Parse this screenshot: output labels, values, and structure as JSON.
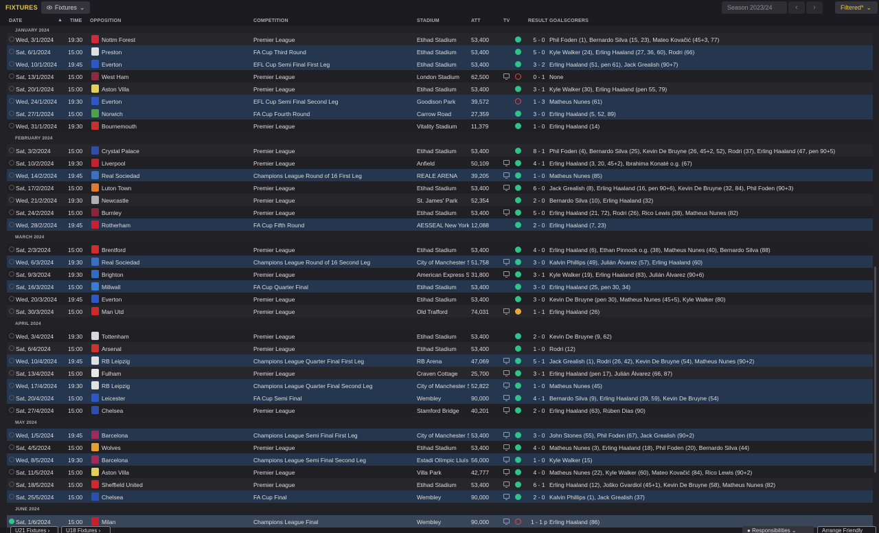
{
  "header": {
    "title": "FIXTURES",
    "view": "Fixtures",
    "season": "Season 2023/24",
    "filter": "Filtered*"
  },
  "columns": {
    "date": "DATE",
    "time": "TIME",
    "opposition": "OPPOSITION",
    "competition": "COMPETITION",
    "stadium": "STADIUM",
    "att": "ATT",
    "tv": "TV",
    "result": "RESULT",
    "goalscorers": "GOALSCORERS"
  },
  "footer": {
    "u21": "U21 Fixtures",
    "u18": "U18 Fixtures",
    "responsibilities": "Responsibilities",
    "arrange": "Arrange Friendly"
  },
  "colors": {
    "accent": "#e8c547",
    "win": "#2fc38a",
    "loss": "#e14a4a",
    "draw": "#e8a93a",
    "highlight": "#24374f"
  },
  "months": [
    {
      "label": "JANUARY 2024",
      "after": -1
    },
    {
      "label": "FEBRUARY 2024",
      "after": 7
    },
    {
      "label": "MARCH 2024",
      "after": 14
    },
    {
      "label": "APRIL 2024",
      "after": 20
    },
    {
      "label": "MAY 2024",
      "after": 27
    },
    {
      "label": "JUNE 2024",
      "after": 33
    }
  ],
  "fixtures": [
    {
      "date": "Wed, 3/1/2024",
      "time": "19:30",
      "opp": "Nottm Forest",
      "crest": "#d3283a",
      "comp": "Premier League",
      "stadium": "Etihad Stadium",
      "att": "53,400",
      "tv": false,
      "r": "W",
      "score": "5 - 0",
      "goals": "Phil Foden (1), Bernardo Silva (15, 23), Mateo Kovačić (45+3, 77)"
    },
    {
      "date": "Sat, 6/1/2024",
      "time": "15:00",
      "opp": "Preston",
      "crest": "#e0e0e0",
      "comp": "FA Cup Third Round",
      "stadium": "Etihad Stadium",
      "att": "53,400",
      "tv": false,
      "r": "W",
      "score": "5 - 0",
      "goals": "Kyle Walker (24), Erling Haaland (27, 36, 60), Rodri (66)"
    },
    {
      "date": "Wed, 10/1/2024",
      "time": "19:45",
      "opp": "Everton",
      "crest": "#2e58c9",
      "comp": "EFL Cup Semi Final First Leg",
      "stadium": "Etihad Stadium",
      "att": "53,400",
      "tv": false,
      "r": "W",
      "score": "3 - 2",
      "goals": "Erling Haaland (51, pen 61), Jack Grealish (90+7)"
    },
    {
      "date": "Sat, 13/1/2024",
      "time": "15:00",
      "opp": "West Ham",
      "crest": "#8e2a3d",
      "comp": "Premier League",
      "stadium": "London Stadium",
      "att": "62,500",
      "tv": true,
      "r": "L",
      "score": "0 - 1",
      "goals": "None"
    },
    {
      "date": "Sat, 20/1/2024",
      "time": "15:00",
      "opp": "Aston Villa",
      "crest": "#e0d05a",
      "comp": "Premier League",
      "stadium": "Etihad Stadium",
      "att": "53,400",
      "tv": false,
      "r": "W",
      "score": "3 - 1",
      "goals": "Kyle Walker (30), Erling Haaland (pen 55, 79)"
    },
    {
      "date": "Wed, 24/1/2024",
      "time": "19:30",
      "opp": "Everton",
      "crest": "#2e58c9",
      "comp": "EFL Cup Semi Final Second Leg",
      "stadium": "Goodison Park",
      "att": "39,572",
      "tv": false,
      "r": "L",
      "score": "1 - 3",
      "goals": "Matheus Nunes (61)"
    },
    {
      "date": "Sat, 27/1/2024",
      "time": "15:00",
      "opp": "Norwich",
      "crest": "#4ba34a",
      "comp": "FA Cup Fourth Round",
      "stadium": "Carrow Road",
      "att": "27,359",
      "tv": false,
      "r": "W",
      "score": "3 - 0",
      "goals": "Erling Haaland (5, 52, 89)"
    },
    {
      "date": "Wed, 31/1/2024",
      "time": "19:30",
      "opp": "Bournemouth",
      "crest": "#c9302c",
      "comp": "Premier League",
      "stadium": "Vitality Stadium",
      "att": "11,379",
      "tv": false,
      "r": "W",
      "score": "1 - 0",
      "goals": "Erling Haaland (14)"
    },
    {
      "date": "Sat, 3/2/2024",
      "time": "15:00",
      "opp": "Crystal Palace",
      "crest": "#2b4fae",
      "comp": "Premier League",
      "stadium": "Etihad Stadium",
      "att": "53,400",
      "tv": false,
      "r": "W",
      "score": "8 - 1",
      "goals": "Phil Foden (4), Bernardo Silva (25), Kevin De Bruyne (26, 45+2, 52), Rodri (37), Erling Haaland (47, pen 90+5)"
    },
    {
      "date": "Sat, 10/2/2024",
      "time": "19:30",
      "opp": "Liverpool",
      "crest": "#c8202f",
      "comp": "Premier League",
      "stadium": "Anfield",
      "att": "50,109",
      "tv": true,
      "r": "W",
      "score": "4 - 1",
      "goals": "Erling Haaland (3, 20, 45+2), Ibrahima Konaté o.g. (67)"
    },
    {
      "date": "Wed, 14/2/2024",
      "time": "19:45",
      "opp": "Real Sociedad",
      "crest": "#3a6fc4",
      "comp": "Champions League Round of 16 First Leg",
      "stadium": "REALE ARENA",
      "att": "39,205",
      "tv": true,
      "r": "W",
      "score": "1 - 0",
      "goals": "Matheus Nunes (85)"
    },
    {
      "date": "Sat, 17/2/2024",
      "time": "15:00",
      "opp": "Luton Town",
      "crest": "#e07a2e",
      "comp": "Premier League",
      "stadium": "Etihad Stadium",
      "att": "53,400",
      "tv": true,
      "r": "W",
      "score": "6 - 0",
      "goals": "Jack Grealish (8), Erling Haaland (16, pen 90+6), Kevin De Bruyne (32, 84), Phil Foden (90+3)"
    },
    {
      "date": "Wed, 21/2/2024",
      "time": "19:30",
      "opp": "Newcastle",
      "crest": "#b0b0b0",
      "comp": "Premier League",
      "stadium": "St. James' Park",
      "att": "52,354",
      "tv": false,
      "r": "W",
      "score": "2 - 0",
      "goals": "Bernardo Silva (10), Erling Haaland (32)"
    },
    {
      "date": "Sat, 24/2/2024",
      "time": "15:00",
      "opp": "Burnley",
      "crest": "#8a2540",
      "comp": "Premier League",
      "stadium": "Etihad Stadium",
      "att": "53,400",
      "tv": true,
      "r": "W",
      "score": "5 - 0",
      "goals": "Erling Haaland (21, 72), Rodri (26), Rico Lewis (38), Matheus Nunes (82)"
    },
    {
      "date": "Wed, 28/2/2024",
      "time": "19:45",
      "opp": "Rotherham",
      "crest": "#c8202f",
      "comp": "FA Cup Fifth Round",
      "stadium": "AESSEAL New York Stadium",
      "att": "12,088",
      "tv": false,
      "r": "W",
      "score": "2 - 0",
      "goals": "Erling Haaland (7, 23)"
    },
    {
      "date": "Sat, 2/3/2024",
      "time": "15:00",
      "opp": "Brentford",
      "crest": "#d62b2b",
      "comp": "Premier League",
      "stadium": "Etihad Stadium",
      "att": "53,400",
      "tv": false,
      "r": "W",
      "score": "4 - 0",
      "goals": "Erling Haaland (6), Ethan Pinnock o.g. (38), Matheus Nunes (40), Bernardo Silva (88)"
    },
    {
      "date": "Wed, 6/3/2024",
      "time": "19:30",
      "opp": "Real Sociedad",
      "crest": "#3a6fc4",
      "comp": "Champions League Round of 16 Second Leg",
      "stadium": "City of Manchester Stadium",
      "att": "51,758",
      "tv": true,
      "r": "W",
      "score": "3 - 0",
      "goals": "Kalvin Phillips (49), Julián Álvarez (57), Erling Haaland (60)"
    },
    {
      "date": "Sat, 9/3/2024",
      "time": "19:30",
      "opp": "Brighton",
      "crest": "#2e6cc6",
      "comp": "Premier League",
      "stadium": "American Express Stadium",
      "att": "31,800",
      "tv": true,
      "r": "W",
      "score": "3 - 1",
      "goals": "Kyle Walker (19), Erling Haaland (83), Julián Álvarez (90+6)"
    },
    {
      "date": "Sat, 16/3/2024",
      "time": "15:00",
      "opp": "Millwall",
      "crest": "#3a7bd5",
      "comp": "FA Cup Quarter Final",
      "stadium": "Etihad Stadium",
      "att": "53,400",
      "tv": false,
      "r": "W",
      "score": "3 - 0",
      "goals": "Erling Haaland (25, pen 30, 34)"
    },
    {
      "date": "Wed, 20/3/2024",
      "time": "19:45",
      "opp": "Everton",
      "crest": "#2e58c9",
      "comp": "Premier League",
      "stadium": "Etihad Stadium",
      "att": "53,400",
      "tv": false,
      "r": "W",
      "score": "3 - 0",
      "goals": "Kevin De Bruyne (pen 30), Matheus Nunes (45+5), Kyle Walker (80)"
    },
    {
      "date": "Sat, 30/3/2024",
      "time": "15:00",
      "opp": "Man Utd",
      "crest": "#d3282b",
      "comp": "Premier League",
      "stadium": "Old Trafford",
      "att": "74,031",
      "tv": true,
      "r": "D",
      "score": "1 - 1",
      "goals": "Erling Haaland (26)"
    },
    {
      "date": "Wed, 3/4/2024",
      "time": "19:30",
      "opp": "Tottenham",
      "crest": "#d8d8d8",
      "comp": "Premier League",
      "stadium": "Etihad Stadium",
      "att": "53,400",
      "tv": false,
      "r": "W",
      "score": "2 - 0",
      "goals": "Kevin De Bruyne (9, 62)"
    },
    {
      "date": "Sat, 6/4/2024",
      "time": "15:00",
      "opp": "Arsenal",
      "crest": "#d0312d",
      "comp": "Premier League",
      "stadium": "Etihad Stadium",
      "att": "53,400",
      "tv": false,
      "r": "W",
      "score": "1 - 0",
      "goals": "Rodri (12)"
    },
    {
      "date": "Wed, 10/4/2024",
      "time": "19:45",
      "opp": "RB Leipzig",
      "crest": "#e0e0e0",
      "comp": "Champions League Quarter Final First Leg",
      "stadium": "RB Arena",
      "att": "47,069",
      "tv": true,
      "r": "W",
      "score": "5 - 1",
      "goals": "Jack Grealish (1), Rodri (26, 42), Kevin De Bruyne (54), Matheus Nunes (90+2)"
    },
    {
      "date": "Sat, 13/4/2024",
      "time": "15:00",
      "opp": "Fulham",
      "crest": "#e8e8e8",
      "comp": "Premier League",
      "stadium": "Craven Cottage",
      "att": "25,700",
      "tv": true,
      "r": "W",
      "score": "3 - 1",
      "goals": "Erling Haaland (pen 17), Julián Álvarez (66, 87)"
    },
    {
      "date": "Wed, 17/4/2024",
      "time": "19:30",
      "opp": "RB Leipzig",
      "crest": "#e0e0e0",
      "comp": "Champions League Quarter Final Second Leg",
      "stadium": "City of Manchester Stadium",
      "att": "52,822",
      "tv": true,
      "r": "W",
      "score": "1 - 0",
      "goals": "Matheus Nunes (45)"
    },
    {
      "date": "Sat, 20/4/2024",
      "time": "15:00",
      "opp": "Leicester",
      "crest": "#2e58c9",
      "comp": "FA Cup Semi Final",
      "stadium": "Wembley",
      "att": "90,000",
      "tv": true,
      "r": "W",
      "score": "4 - 1",
      "goals": "Bernardo Silva (9), Erling Haaland (39, 59), Kevin De Bruyne (54)"
    },
    {
      "date": "Sat, 27/4/2024",
      "time": "15:00",
      "opp": "Chelsea",
      "crest": "#2b4fae",
      "comp": "Premier League",
      "stadium": "Stamford Bridge",
      "att": "40,201",
      "tv": true,
      "r": "W",
      "score": "2 - 0",
      "goals": "Erling Haaland (63), Rúben Dias (90)"
    },
    {
      "date": "Wed, 1/5/2024",
      "time": "19:45",
      "opp": "Barcelona",
      "crest": "#a5285a",
      "comp": "Champions League Semi Final First Leg",
      "stadium": "City of Manchester Stadium",
      "att": "53,400",
      "tv": true,
      "r": "W",
      "score": "3 - 0",
      "goals": "John Stones (55), Phil Foden (67), Jack Grealish (90+2)"
    },
    {
      "date": "Sat, 4/5/2024",
      "time": "15:00",
      "opp": "Wolves",
      "crest": "#e3a12b",
      "comp": "Premier League",
      "stadium": "Etihad Stadium",
      "att": "53,400",
      "tv": true,
      "r": "W",
      "score": "4 - 0",
      "goals": "Matheus Nunes (3), Erling Haaland (18), Phil Foden (20), Bernardo Silva (44)"
    },
    {
      "date": "Wed, 8/5/2024",
      "time": "19:30",
      "opp": "Barcelona",
      "crest": "#a5285a",
      "comp": "Champions League Semi Final Second Leg",
      "stadium": "Estadi Olímpic Lluís Companys",
      "att": "56,000",
      "tv": true,
      "r": "W",
      "score": "1 - 0",
      "goals": "Kyle Walker (15)"
    },
    {
      "date": "Sat, 11/5/2024",
      "time": "15:00",
      "opp": "Aston Villa",
      "crest": "#e0d05a",
      "comp": "Premier League",
      "stadium": "Villa Park",
      "att": "42,777",
      "tv": true,
      "r": "W",
      "score": "4 - 0",
      "goals": "Matheus Nunes (22), Kyle Walker (60), Mateo Kovačić (84), Rico Lewis (90+2)"
    },
    {
      "date": "Sat, 18/5/2024",
      "time": "15:00",
      "opp": "Sheffield United",
      "crest": "#d3282b",
      "comp": "Premier League",
      "stadium": "Etihad Stadium",
      "att": "53,400",
      "tv": true,
      "r": "W",
      "score": "6 - 1",
      "goals": "Erling Haaland (12), Joško Gvardiol (45+1), Kevin De Bruyne (58), Matheus Nunes (82)"
    },
    {
      "date": "Sat, 25/5/2024",
      "time": "15:00",
      "opp": "Chelsea",
      "crest": "#2b4fae",
      "comp": "FA Cup Final",
      "stadium": "Wembley",
      "att": "90,000",
      "tv": true,
      "r": "W",
      "score": "2 - 0",
      "goals": "Kalvin Phillips (1), Jack Grealish (37)"
    },
    {
      "date": "Sat, 1/6/2024",
      "time": "15:00",
      "opp": "Milan",
      "crest": "#c8202f",
      "comp": "Champions League Final",
      "stadium": "Wembley",
      "att": "90,000",
      "tv": true,
      "r": "L",
      "score": "1 - 1 p",
      "goals": "Erling Haaland (86)"
    }
  ]
}
